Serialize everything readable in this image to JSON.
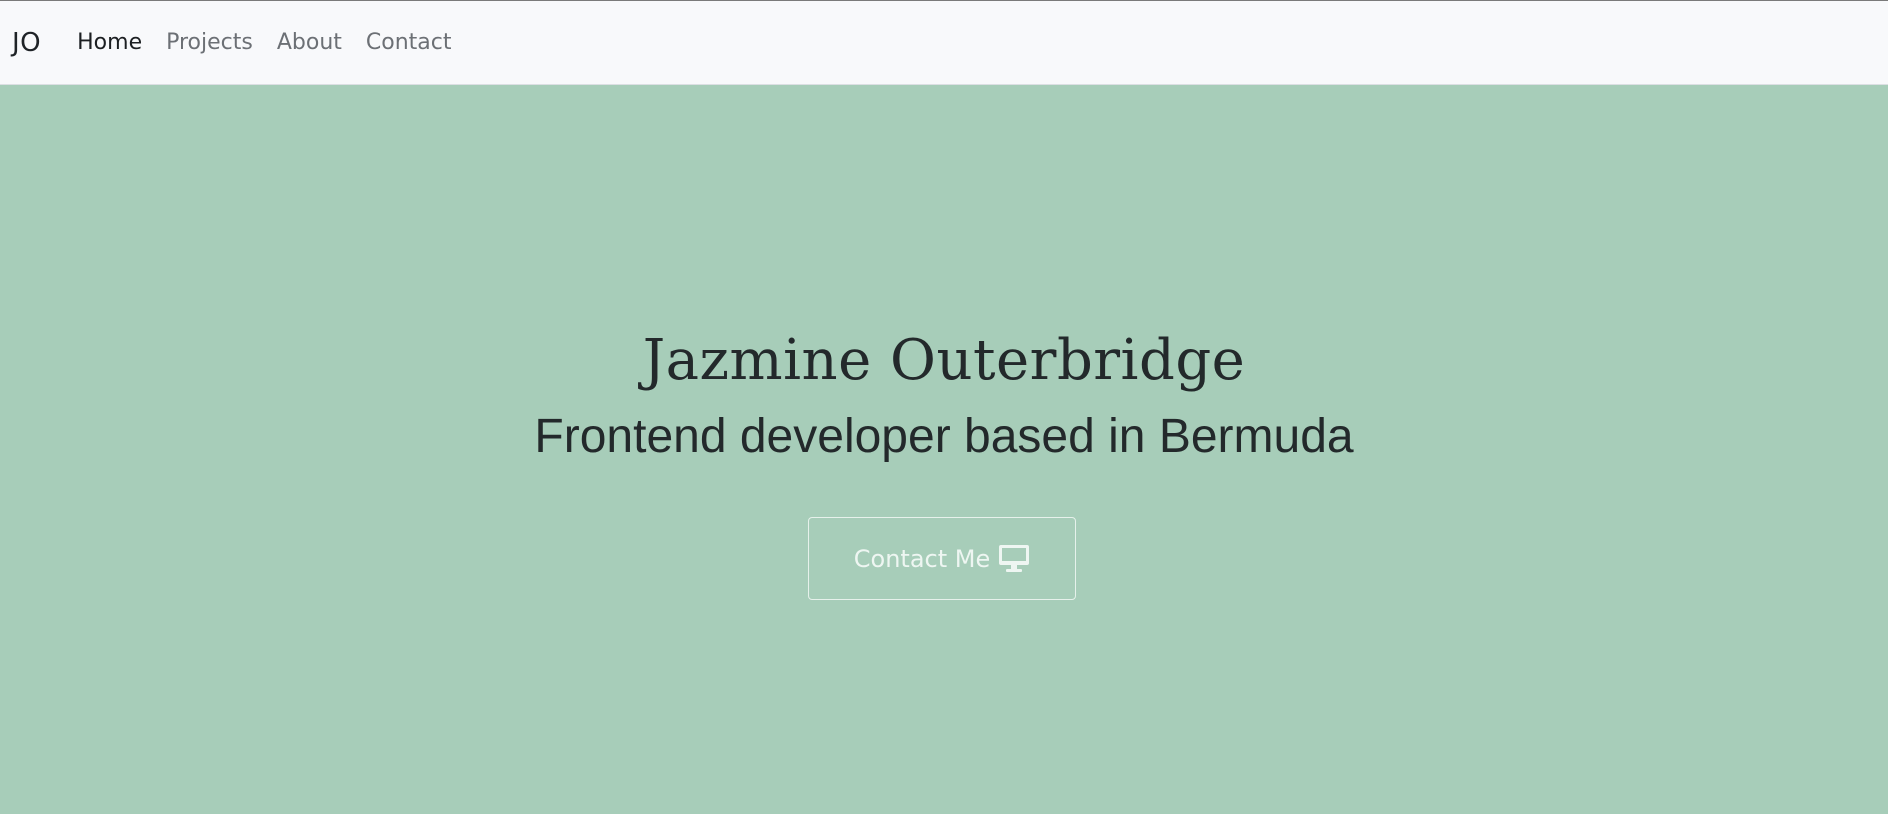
{
  "navbar": {
    "brand": "JO",
    "links": [
      {
        "label": "Home",
        "active": true
      },
      {
        "label": "Projects",
        "active": false
      },
      {
        "label": "About",
        "active": false
      },
      {
        "label": "Contact",
        "active": false
      }
    ]
  },
  "hero": {
    "title": "Jazmine Outerbridge",
    "subtitle": "Frontend developer based in Bermuda",
    "button_label": "Contact Me",
    "button_icon": "monitor-icon"
  },
  "colors": {
    "hero_background": "#a7cdb9",
    "navbar_background": "#f8f9fb",
    "text_dark": "#23292b",
    "button_text": "#eef6f2"
  }
}
